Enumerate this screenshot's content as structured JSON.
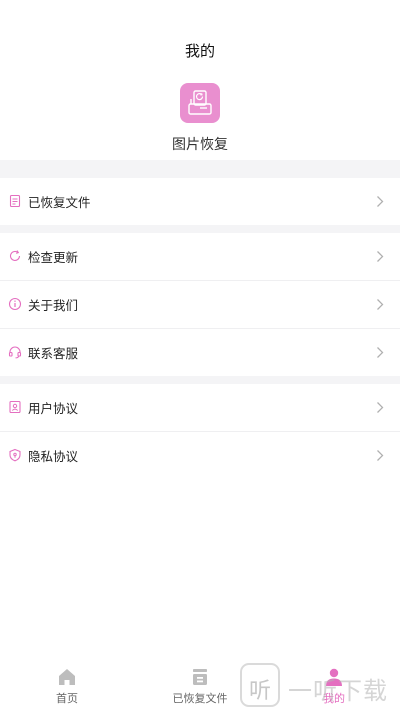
{
  "header": {
    "title": "我的"
  },
  "app": {
    "name": "图片恢复",
    "icon": "photo-recovery-icon"
  },
  "menu_group_1": [
    {
      "label": "已恢复文件",
      "icon": "document-icon"
    }
  ],
  "menu_group_2": [
    {
      "label": "检查更新",
      "icon": "refresh-icon"
    },
    {
      "label": "关于我们",
      "icon": "info-icon"
    },
    {
      "label": "联系客服",
      "icon": "headset-icon"
    }
  ],
  "menu_group_3": [
    {
      "label": "用户协议",
      "icon": "user-document-icon"
    },
    {
      "label": "隐私协议",
      "icon": "shield-icon"
    }
  ],
  "tabbar": {
    "tabs": [
      {
        "label": "首页",
        "icon": "home-icon",
        "active": false
      },
      {
        "label": "已恢复文件",
        "icon": "archive-icon",
        "active": false
      },
      {
        "label": "我的",
        "icon": "person-icon",
        "active": true
      }
    ]
  },
  "watermark": {
    "glyph": "听",
    "text": "一听下载"
  },
  "colors": {
    "accent": "#e46fc0",
    "icon_bg": "#e98fcf",
    "gap": "#f4f4f6",
    "chevron": "#b0b0b0"
  }
}
